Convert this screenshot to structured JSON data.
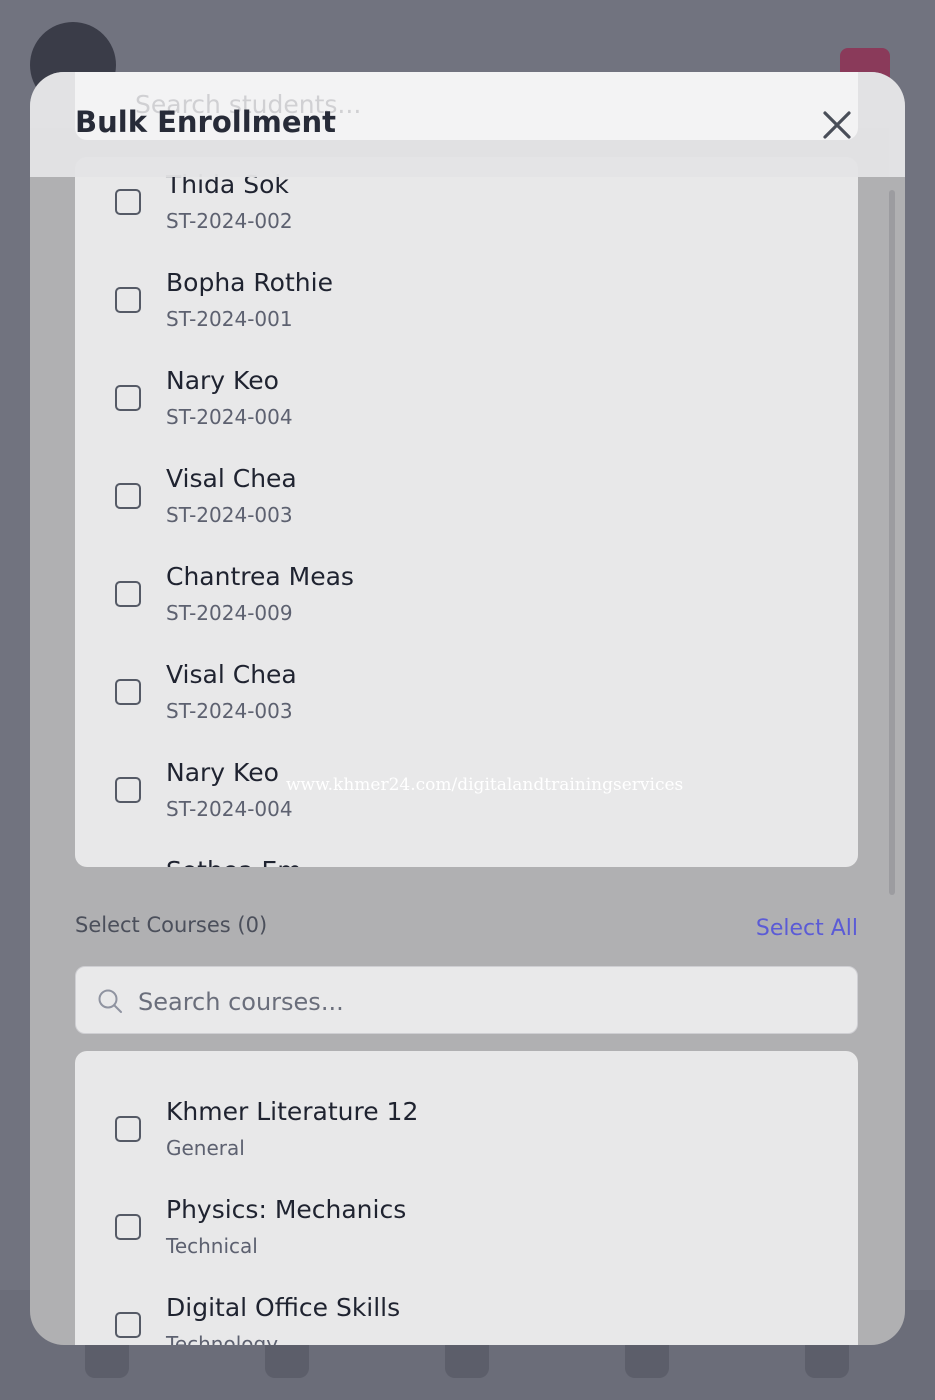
{
  "modal": {
    "title": "Bulk Enrollment",
    "student_search_placeholder": "Search students..."
  },
  "students": [
    {
      "name": "Thida Sok",
      "id": "ST-2024-002"
    },
    {
      "name": "Bopha Rothie",
      "id": "ST-2024-001"
    },
    {
      "name": "Nary Keo",
      "id": "ST-2024-004"
    },
    {
      "name": "Visal Chea",
      "id": "ST-2024-003"
    },
    {
      "name": "Chantrea Meas",
      "id": "ST-2024-009"
    },
    {
      "name": "Visal Chea",
      "id": "ST-2024-003"
    },
    {
      "name": "Nary Keo",
      "id": "ST-2024-004"
    },
    {
      "name": "Sothea Em",
      "id": ""
    }
  ],
  "courses_section": {
    "label": "Select Courses (0)",
    "select_all": "Select All",
    "search_placeholder": "Search courses..."
  },
  "courses": [
    {
      "name": "Khmer Literature 12",
      "category": "General"
    },
    {
      "name": "Physics: Mechanics",
      "category": "Technical"
    },
    {
      "name": "Digital Office Skills",
      "category": "Technology"
    }
  ],
  "watermark": "www.khmer24.com/digitalandtrainingservices",
  "colors": {
    "accent": "#5b5bd6",
    "text_primary": "#1f2330",
    "text_secondary": "#5d6170"
  }
}
